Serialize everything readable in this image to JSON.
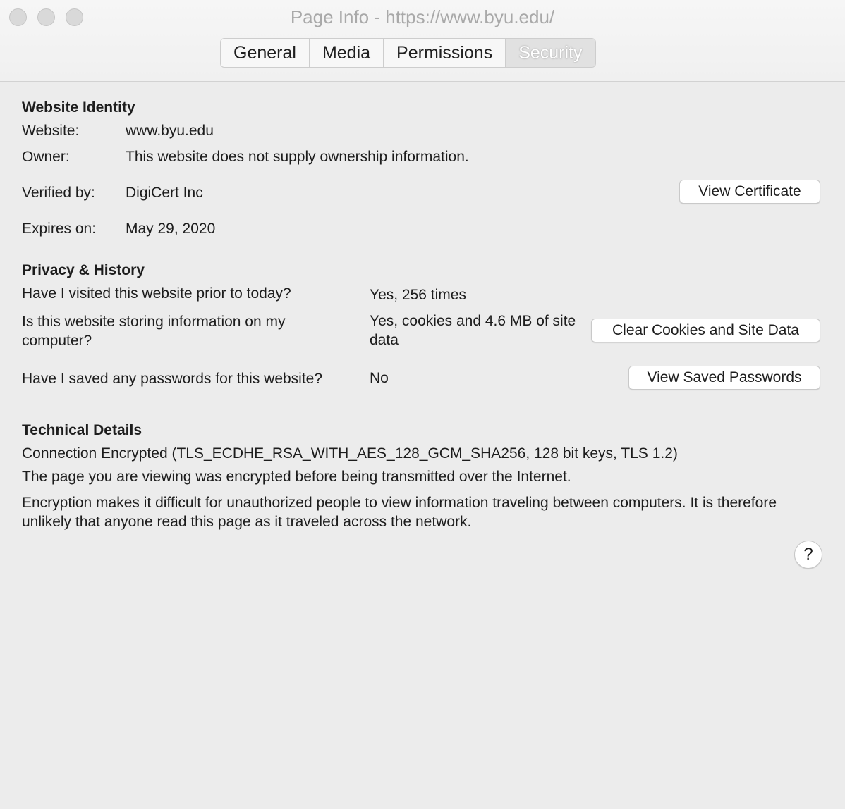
{
  "window": {
    "title": "Page Info - https://www.byu.edu/",
    "tabs": [
      "General",
      "Media",
      "Permissions",
      "Security"
    ],
    "active_tab": "Security"
  },
  "identity": {
    "heading": "Website Identity",
    "website_label": "Website:",
    "website_value": "www.byu.edu",
    "owner_label": "Owner:",
    "owner_value": "This website does not supply ownership information.",
    "verified_label": "Verified by:",
    "verified_value": "DigiCert Inc",
    "view_certificate": "View Certificate",
    "expires_label": "Expires on:",
    "expires_value": "May 29, 2020"
  },
  "privacy": {
    "heading": "Privacy & History",
    "visited_q": "Have I visited this website prior to today?",
    "visited_a": "Yes, 256 times",
    "storing_q": "Is this website storing information on my computer?",
    "storing_a": "Yes, cookies and 4.6 MB of site data",
    "clear_button": "Clear Cookies and Site Data",
    "passwords_q": "Have I saved any passwords for this website?",
    "passwords_a": "No",
    "passwords_button": "View Saved Passwords"
  },
  "technical": {
    "heading": "Technical Details",
    "connection": "Connection Encrypted (TLS_ECDHE_RSA_WITH_AES_128_GCM_SHA256, 128 bit keys, TLS 1.2)",
    "line1": "The page you are viewing was encrypted before being transmitted over the Internet.",
    "line2": "Encryption makes it difficult for unauthorized people to view information traveling between computers. It is therefore unlikely that anyone read this page as it traveled across the network."
  },
  "help": {
    "label": "?"
  }
}
